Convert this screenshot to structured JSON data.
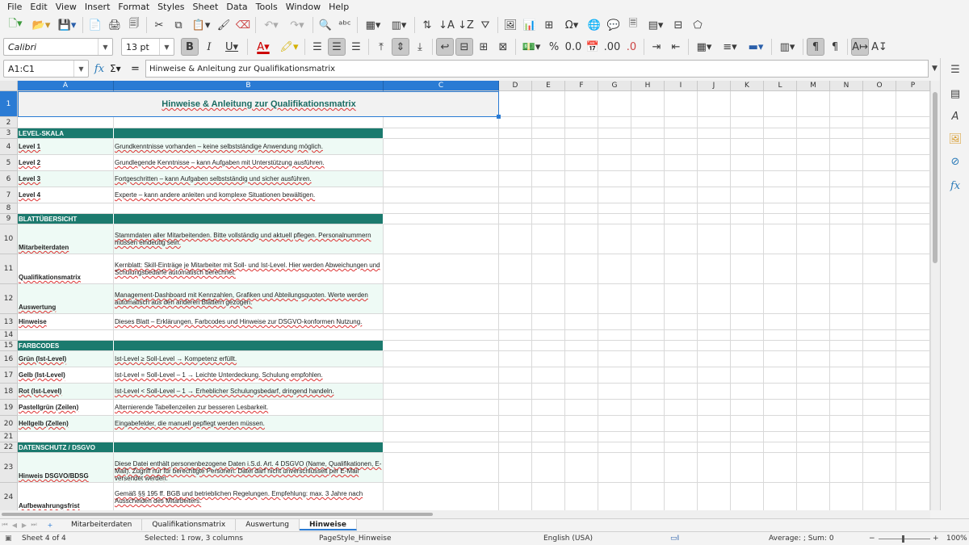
{
  "menu": [
    "File",
    "Edit",
    "View",
    "Insert",
    "Format",
    "Styles",
    "Sheet",
    "Data",
    "Tools",
    "Window",
    "Help"
  ],
  "font": {
    "name": "Calibri",
    "size": "13 pt"
  },
  "namebox": "A1:C1",
  "formula": "Hinweise & Anleitung zur Qualifikationsmatrix",
  "columns": [
    "A",
    "B",
    "C",
    "D",
    "E",
    "F",
    "G",
    "H",
    "I",
    "J",
    "K",
    "L",
    "M",
    "N",
    "O",
    "P"
  ],
  "title": "Hinweise & Anleitung zur Qualifikationsmatrix",
  "rows": [
    {
      "n": "1"
    },
    {
      "n": "2"
    },
    {
      "n": "3",
      "type": "section",
      "a": "LEVEL-SKALA"
    },
    {
      "n": "4",
      "a": "Level 1",
      "b": "Grundkenntnisse vorhanden – keine selbstständige Anwendung möglich."
    },
    {
      "n": "5",
      "a": "Level 2",
      "b": "Grundlegende Kenntnisse – kann Aufgaben mit Unterstützung ausführen."
    },
    {
      "n": "6",
      "a": "Level 3",
      "b": "Fortgeschritten – kann Aufgaben selbstständig und sicher ausführen."
    },
    {
      "n": "7",
      "a": "Level 4",
      "b": "Experte – kann andere anleiten und komplexe Situationen bewältigen."
    },
    {
      "n": "8"
    },
    {
      "n": "9",
      "type": "section",
      "a": "BLATTÜBERSICHT"
    },
    {
      "n": "10",
      "a": "Mitarbeiterdaten",
      "b": "Stammdaten aller Mitarbeitenden. Bitte vollständig und aktuell pflegen. Personalnummern müssen eindeutig sein."
    },
    {
      "n": "11",
      "a": "Qualifikationsmatrix",
      "b": "Kernblatt: Skill-Einträge je Mitarbeiter mit Soll- und Ist-Level. Hier werden Abweichungen und Schulungsbedarfe automatisch berechnet."
    },
    {
      "n": "12",
      "a": "Auswertung",
      "b": "Management-Dashboard mit Kennzahlen, Grafiken und Abteilungsquoten. Werte werden automatisch aus den anderen Blättern gezogen."
    },
    {
      "n": "13",
      "a": "Hinweise",
      "b": "Dieses Blatt – Erklärungen, Farbcodes und Hinweise zur DSGVO-konformen Nutzung."
    },
    {
      "n": "14"
    },
    {
      "n": "15",
      "type": "section",
      "a": "FARBCODES"
    },
    {
      "n": "16",
      "a": "Grün (Ist-Level)",
      "b": "Ist-Level ≥ Soll-Level → Kompetenz erfüllt."
    },
    {
      "n": "17",
      "a": "Gelb (Ist-Level)",
      "b": "Ist-Level = Soll-Level – 1 → Leichte Unterdeckung. Schulung empfohlen."
    },
    {
      "n": "18",
      "a": "Rot (Ist-Level)",
      "b": "Ist-Level < Soll-Level – 1 → Erheblicher Schulungsbedarf, dringend handeln."
    },
    {
      "n": "19",
      "a": "Pastellgrün (Zeilen)",
      "b": "Alternierende Tabellenzeilen zur besseren Lesbarkeit."
    },
    {
      "n": "20",
      "a": "Hellgelb (Zellen)",
      "b": "Eingabefelder, die manuell gepflegt werden müssen."
    },
    {
      "n": "21"
    },
    {
      "n": "22",
      "type": "section",
      "a": "DATENSCHUTZ / DSGVO"
    },
    {
      "n": "23",
      "a": "Hinweis DSGVO/BDSG",
      "b": "Diese Datei enthält personenbezogene Daten i.S.d. Art. 4 DSGVO (Name, Qualifikationen, E-Mail). Zugriff nur für berechtigte Personen. Datei darf nicht unverschlüsselt per E-Mail versendet werden."
    },
    {
      "n": "24",
      "a": "Aufbewahrungsfrist",
      "b": "Gemäß §§ 195 ff. BGB und betrieblichen Regelungen. Empfehlung: max. 3 Jahre nach Ausscheiden des Mitarbeiters."
    }
  ],
  "tabs": [
    "Mitarbeiterdaten",
    "Qualifikationsmatrix",
    "Auswertung",
    "Hinweise"
  ],
  "active_tab": "Hinweise",
  "status": {
    "sheet": "Sheet 4 of 4",
    "selected": "Selected: 1 row, 3 columns",
    "pagestyle": "PageStyle_Hinweise",
    "lang": "English (USA)",
    "sum": "Average: ; Sum: 0",
    "zoom": "100%"
  },
  "colors": {
    "section": "#1b7a6e",
    "alt": "#eefaf5",
    "title_bg": "#f2f2f2",
    "title_text": "#1b6b62",
    "selection": "#2a7bd4"
  }
}
